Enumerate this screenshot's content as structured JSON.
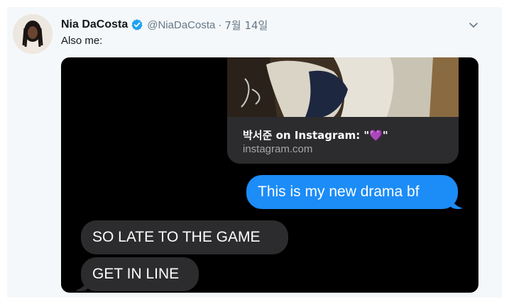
{
  "tweet": {
    "display_name": "Nia DaCosta",
    "handle": "@NiaDaCosta",
    "separator": "·",
    "date": "7월 14일",
    "text": "Also me:",
    "icons": {
      "verified": "verified-badge-icon",
      "menu": "chevron-down-icon"
    },
    "colors": {
      "verified": "#1da1f2",
      "secondary_text": "#657786"
    }
  },
  "screenshot": {
    "link_preview": {
      "title": "박서준 on Instagram: \"💜\"",
      "domain": "instagram.com"
    },
    "messages": [
      {
        "sender": "me",
        "text": "This is my new drama bf"
      },
      {
        "sender": "them",
        "text": "SO LATE TO THE GAME"
      },
      {
        "sender": "them",
        "text": "GET IN LINE"
      }
    ],
    "colors": {
      "sent_bubble": "#1c8cf7",
      "received_bubble": "#2c2c2e",
      "background": "#000000"
    }
  }
}
